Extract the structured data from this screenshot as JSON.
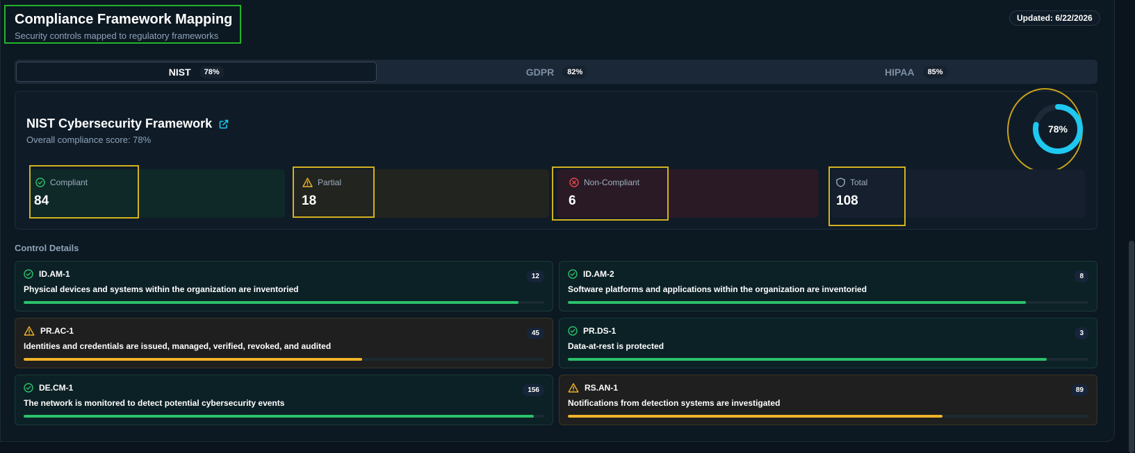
{
  "header": {
    "title": "Compliance Framework Mapping",
    "subtitle": "Security controls mapped to regulatory frameworks",
    "updated": "Updated: 6/22/2026"
  },
  "tabs": [
    {
      "label": "NIST",
      "pct": "78%",
      "active": true
    },
    {
      "label": "GDPR",
      "pct": "82%",
      "active": false
    },
    {
      "label": "HIPAA",
      "pct": "85%",
      "active": false
    }
  ],
  "framework": {
    "title": "NIST Cybersecurity Framework",
    "subtitle": "Overall compliance score: 78%",
    "score_label": "78%",
    "score_fraction": 0.78
  },
  "stats": [
    {
      "label": "Compliant",
      "value": "84",
      "icon": "check-circle-icon"
    },
    {
      "label": "Partial",
      "value": "18",
      "icon": "warning-triangle-icon"
    },
    {
      "label": "Non-Compliant",
      "value": "6",
      "icon": "x-circle-icon"
    },
    {
      "label": "Total",
      "value": "108",
      "icon": "shield-icon"
    }
  ],
  "controls_section_title": "Control Details",
  "controls": [
    {
      "id": "ID.AM-1",
      "desc": "Physical devices and systems within the organization are inventoried",
      "count": "12",
      "status": "compliant",
      "progress": 0.95
    },
    {
      "id": "ID.AM-2",
      "desc": "Software platforms and applications within the organization are inventoried",
      "count": "8",
      "status": "compliant",
      "progress": 0.88
    },
    {
      "id": "PR.AC-1",
      "desc": "Identities and credentials are issued, managed, verified, revoked, and audited",
      "count": "45",
      "status": "partial",
      "progress": 0.65
    },
    {
      "id": "PR.DS-1",
      "desc": "Data-at-rest is protected",
      "count": "3",
      "status": "compliant",
      "progress": 0.92
    },
    {
      "id": "DE.CM-1",
      "desc": "The network is monitored to detect potential cybersecurity events",
      "count": "156",
      "status": "compliant",
      "progress": 0.98
    },
    {
      "id": "RS.AN-1",
      "desc": "Notifications from detection systems are investigated",
      "count": "89",
      "status": "partial",
      "progress": 0.72
    }
  ],
  "colors": {
    "compliant": "#2bc26a",
    "partial": "#f0b429",
    "noncompliant": "#e5484d",
    "accent": "#1ec8f0"
  }
}
